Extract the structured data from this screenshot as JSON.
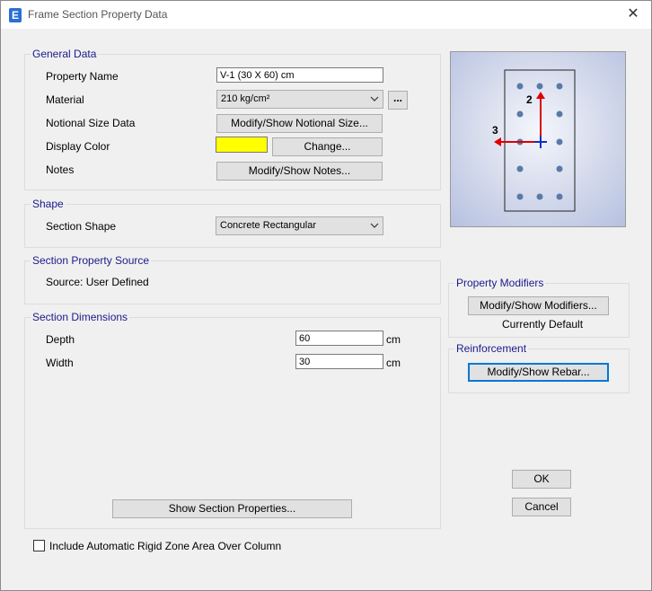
{
  "window": {
    "title": "Frame Section Property Data",
    "app_letter": "E",
    "close_glyph": "✕"
  },
  "general": {
    "group_label": "General Data",
    "property_name_label": "Property Name",
    "property_name_value": "V-1 (30 X 60) cm",
    "material_label": "Material",
    "material_value": "210 kg/cm²",
    "ellipsis_button": "...",
    "notional_label": "Notional Size Data",
    "notional_button": "Modify/Show Notional Size...",
    "color_label": "Display Color",
    "color_value": "#ffff00",
    "change_button": "Change...",
    "notes_label": "Notes",
    "notes_button": "Modify/Show Notes..."
  },
  "shape": {
    "group_label": "Shape",
    "section_shape_label": "Section Shape",
    "section_shape_value": "Concrete Rectangular"
  },
  "source": {
    "group_label": "Section Property Source",
    "source_text": "Source:  User Defined"
  },
  "dimensions": {
    "group_label": "Section Dimensions",
    "depth_label": "Depth",
    "depth_value": "60",
    "depth_unit": "cm",
    "width_label": "Width",
    "width_value": "30",
    "width_unit": "cm",
    "show_props_button": "Show Section Properties..."
  },
  "preview": {
    "axis_2_label": "2",
    "axis_3_label": "3",
    "axis_2_color": "#e00000",
    "axis_3_color": "#e00000",
    "bar_color": "#5a7aa8"
  },
  "modifiers": {
    "group_label": "Property Modifiers",
    "button": "Modify/Show Modifiers...",
    "status": "Currently Default"
  },
  "reinforcement": {
    "group_label": "Reinforcement",
    "button": "Modify/Show Rebar..."
  },
  "actions": {
    "ok": "OK",
    "cancel": "Cancel"
  },
  "rigid_zone": {
    "label": "Include Automatic Rigid Zone Area Over Column",
    "checked": false
  }
}
